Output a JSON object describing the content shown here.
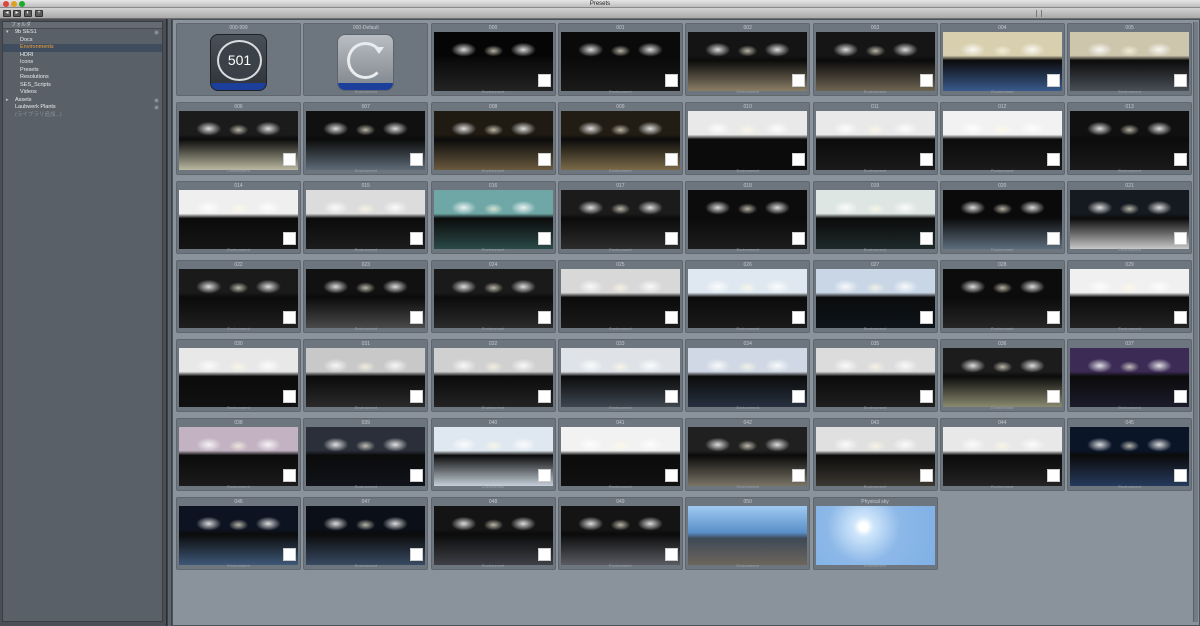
{
  "window": {
    "title": "Presets"
  },
  "toolbar": {
    "back": "◂",
    "forward": "▸",
    "home": "◐",
    "add": "+"
  },
  "sidebar": {
    "header": "フォルダ",
    "items": [
      {
        "label": "9b SES1",
        "indent": 0,
        "arrow": "▾",
        "gear": true
      },
      {
        "label": "Docs",
        "indent": 1
      },
      {
        "label": "Environments",
        "indent": 1,
        "selected": true
      },
      {
        "label": "HDRI",
        "indent": 1
      },
      {
        "label": "Icons",
        "indent": 1
      },
      {
        "label": "Presets",
        "indent": 1
      },
      {
        "label": "Resolutions",
        "indent": 1
      },
      {
        "label": "SES_Scripts",
        "indent": 1
      },
      {
        "label": "Videos",
        "indent": 1
      },
      {
        "label": "Assets",
        "indent": 0,
        "arrow": "▸",
        "gear": true
      },
      {
        "label": "Laubwerk Plants",
        "indent": 0,
        "gear": true
      },
      {
        "label": "(ライブラリ追加...)",
        "indent": 0,
        "dim": true
      }
    ]
  },
  "presets": [
    {
      "cap": "000-999",
      "sub": "",
      "icon": "counter",
      "count": "501"
    },
    {
      "cap": "000-Default",
      "sub": "Environment",
      "icon": "refresh"
    },
    {
      "cap": "000",
      "sub": "Environment",
      "style": "a"
    },
    {
      "cap": "001",
      "sub": "Environment",
      "style": "b"
    },
    {
      "cap": "002",
      "sub": "Environment",
      "style": "c"
    },
    {
      "cap": "003",
      "sub": "Environment",
      "style": "d"
    },
    {
      "cap": "004",
      "sub": "Environment",
      "style": "e"
    },
    {
      "cap": "005",
      "sub": "Environment",
      "style": "f"
    },
    {
      "cap": "006",
      "sub": "Environment",
      "style": "g"
    },
    {
      "cap": "007",
      "sub": "Environment",
      "style": "h"
    },
    {
      "cap": "008",
      "sub": "Environment",
      "style": "i"
    },
    {
      "cap": "009",
      "sub": "Environment",
      "style": "j"
    },
    {
      "cap": "010",
      "sub": "Environment",
      "style": "k"
    },
    {
      "cap": "011",
      "sub": "Environment",
      "style": "l"
    },
    {
      "cap": "012",
      "sub": "Environment",
      "style": "m"
    },
    {
      "cap": "013",
      "sub": "Environment",
      "style": "n"
    },
    {
      "cap": "014",
      "sub": "Environment",
      "style": "o"
    },
    {
      "cap": "015",
      "sub": "Environment",
      "style": "p"
    },
    {
      "cap": "016",
      "sub": "Environment",
      "style": "q"
    },
    {
      "cap": "017",
      "sub": "Environment",
      "style": "r"
    },
    {
      "cap": "018",
      "sub": "Environment",
      "style": "s"
    },
    {
      "cap": "019",
      "sub": "Environment",
      "style": "t"
    },
    {
      "cap": "020",
      "sub": "Environment",
      "style": "u"
    },
    {
      "cap": "021",
      "sub": "Environment",
      "style": "v"
    },
    {
      "cap": "022",
      "sub": "Environment",
      "style": "w"
    },
    {
      "cap": "023",
      "sub": "Environment",
      "style": "x"
    },
    {
      "cap": "024",
      "sub": "Environment",
      "style": "y"
    },
    {
      "cap": "025",
      "sub": "Environment",
      "style": "z"
    },
    {
      "cap": "026",
      "sub": "Environment",
      "style": "a2"
    },
    {
      "cap": "027",
      "sub": "Environment",
      "style": "b2"
    },
    {
      "cap": "028",
      "sub": "Environment",
      "style": "c2"
    },
    {
      "cap": "029",
      "sub": "Environment",
      "style": "d2"
    },
    {
      "cap": "030",
      "sub": "Environment",
      "style": "e2"
    },
    {
      "cap": "031",
      "sub": "Environment",
      "style": "f2"
    },
    {
      "cap": "032",
      "sub": "Environment",
      "style": "g2"
    },
    {
      "cap": "033",
      "sub": "Environment",
      "style": "h2"
    },
    {
      "cap": "034",
      "sub": "Environment",
      "style": "i2"
    },
    {
      "cap": "035",
      "sub": "Environment",
      "style": "j2"
    },
    {
      "cap": "036",
      "sub": "Environment",
      "style": "k2"
    },
    {
      "cap": "037",
      "sub": "Environment",
      "style": "l2"
    },
    {
      "cap": "038",
      "sub": "Environment",
      "style": "m2"
    },
    {
      "cap": "039",
      "sub": "Environment",
      "style": "n2"
    },
    {
      "cap": "040",
      "sub": "Environment",
      "style": "o2"
    },
    {
      "cap": "041",
      "sub": "Environment",
      "style": "p2"
    },
    {
      "cap": "042",
      "sub": "Environment",
      "style": "q2"
    },
    {
      "cap": "043",
      "sub": "Environment",
      "style": "r2"
    },
    {
      "cap": "044",
      "sub": "Environment",
      "style": "s2"
    },
    {
      "cap": "045",
      "sub": "Environment",
      "style": "t2"
    },
    {
      "cap": "046",
      "sub": "Environment",
      "style": "u2"
    },
    {
      "cap": "047",
      "sub": "Environment",
      "style": "v2"
    },
    {
      "cap": "048",
      "sub": "Environment",
      "style": "w2"
    },
    {
      "cap": "049",
      "sub": "Environment",
      "style": "x2"
    },
    {
      "cap": "050",
      "sub": "Environment",
      "style": "sky1",
      "nochk": true
    },
    {
      "cap": "Physical sky",
      "sub": "Environment",
      "style": "sky2",
      "nochk": true
    }
  ]
}
